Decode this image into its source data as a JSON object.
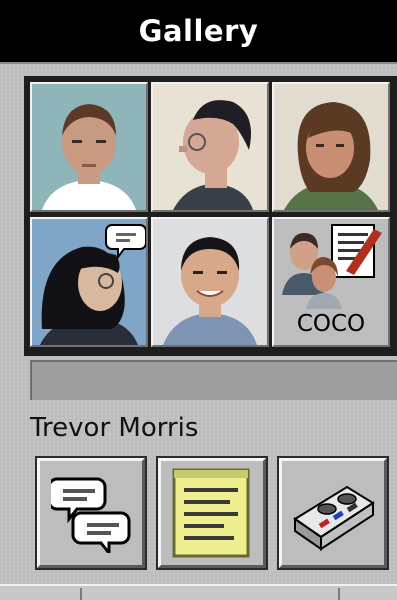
{
  "window": {
    "title": "Gallery"
  },
  "gallery": {
    "cells": [
      {
        "kind": "photo",
        "bg": "#8fb4b9",
        "skin": "#c99a82",
        "hair": "#5b3b28",
        "shirt": "#ffffff"
      },
      {
        "kind": "photo",
        "bg": "#e8e2d4",
        "skin": "#d4a894",
        "hair": "#1e1e24",
        "shirt": "#3a4048"
      },
      {
        "kind": "photo",
        "bg": "#e2dcd0",
        "skin": "#c98f74",
        "hair": "#5a3a22",
        "shirt": "#567246"
      },
      {
        "kind": "photo",
        "bg": "#7fa6c6",
        "skin": "#d9b8a0",
        "hair": "#121216",
        "shirt": "#2a2d3a"
      },
      {
        "kind": "photo",
        "bg": "#dcdee0",
        "skin": "#d8a88a",
        "hair": "#151518",
        "shirt": "#7f93b4"
      },
      {
        "kind": "group",
        "label": "COCO"
      }
    ]
  },
  "selection": {
    "name": "Trevor Morris"
  },
  "toolbar": {
    "buttons": [
      {
        "icon": "chat-bubbles-icon"
      },
      {
        "icon": "notes-document-icon"
      },
      {
        "icon": "tape-recorder-icon"
      }
    ]
  },
  "colors": {
    "titlebar": "#000000",
    "panel": "#bdbdbd",
    "frame": "#1e1e1e"
  }
}
